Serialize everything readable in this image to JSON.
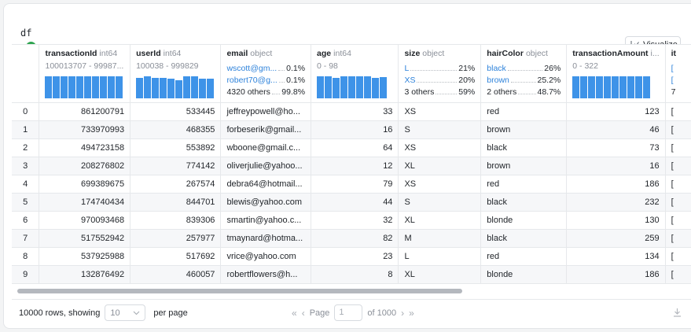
{
  "cell": {
    "code": "df",
    "visualize_label": "Visualize"
  },
  "columns": [
    {
      "name": "transactionId",
      "type": "int64",
      "kind": "numeric",
      "range": "100013707 - 99987...",
      "hist": [
        0.86,
        0.86,
        0.86,
        0.86,
        0.86,
        0.86,
        0.86,
        0.86,
        0.86,
        0.86
      ]
    },
    {
      "name": "userId",
      "type": "int64",
      "kind": "numeric",
      "range": "100038 - 999829",
      "hist": [
        0.8,
        0.86,
        0.8,
        0.8,
        0.77,
        0.72,
        0.86,
        0.86,
        0.79,
        0.79
      ]
    },
    {
      "name": "email",
      "type": "object",
      "kind": "categorical",
      "cats": [
        {
          "label": "wscott@gm...",
          "pct": "0.1%"
        },
        {
          "label": "robert70@g...",
          "pct": "0.1%"
        },
        {
          "label": "4320 others",
          "pct": "99.8%",
          "other": true
        }
      ]
    },
    {
      "name": "age",
      "type": "int64",
      "kind": "numeric",
      "range": "0 - 98",
      "hist": [
        0.86,
        0.86,
        0.8,
        0.86,
        0.86,
        0.86,
        0.86,
        0.8,
        0.83
      ]
    },
    {
      "name": "size",
      "type": "object",
      "kind": "categorical",
      "cats": [
        {
          "label": "L",
          "pct": "21%"
        },
        {
          "label": "XS",
          "pct": "20%"
        },
        {
          "label": "3 others",
          "pct": "59%",
          "other": true
        }
      ]
    },
    {
      "name": "hairColor",
      "type": "object",
      "kind": "categorical",
      "cats": [
        {
          "label": "black",
          "pct": "26%"
        },
        {
          "label": "brown",
          "pct": "25.2%"
        },
        {
          "label": "2 others",
          "pct": "48.7%",
          "other": true
        }
      ]
    },
    {
      "name": "transactionAmount",
      "type": "i...",
      "kind": "numeric",
      "range": "0 - 322",
      "hist": [
        0.86,
        0.86,
        0.86,
        0.86,
        0.86,
        0.86,
        0.86,
        0.86,
        0.86,
        0.86
      ]
    },
    {
      "name": "it",
      "type": "",
      "kind": "partial",
      "cats": [
        {
          "label": "[",
          "pct": ""
        },
        {
          "label": "[",
          "pct": ""
        },
        {
          "label": "7",
          "pct": "",
          "other": true
        }
      ]
    }
  ],
  "rows": [
    [
      "0",
      "861200791",
      "533445",
      "jeffreypowell@ho...",
      "33",
      "XS",
      "red",
      "123",
      "["
    ],
    [
      "1",
      "733970993",
      "468355",
      "forbeserik@gmail...",
      "16",
      "S",
      "brown",
      "46",
      "["
    ],
    [
      "2",
      "494723158",
      "553892",
      "wboone@gmail.c...",
      "64",
      "XS",
      "black",
      "73",
      "["
    ],
    [
      "3",
      "208276802",
      "774142",
      "oliverjulie@yahoo...",
      "12",
      "XL",
      "brown",
      "16",
      "["
    ],
    [
      "4",
      "699389675",
      "267574",
      "debra64@hotmail...",
      "79",
      "XS",
      "red",
      "186",
      "["
    ],
    [
      "5",
      "174740434",
      "844701",
      "blewis@yahoo.com",
      "44",
      "S",
      "black",
      "232",
      "["
    ],
    [
      "6",
      "970093468",
      "839306",
      "smartin@yahoo.c...",
      "32",
      "XL",
      "blonde",
      "130",
      "["
    ],
    [
      "7",
      "517552942",
      "257977",
      "tmaynard@hotma...",
      "82",
      "M",
      "black",
      "259",
      "["
    ],
    [
      "8",
      "537925988",
      "517692",
      "vrice@yahoo.com",
      "23",
      "L",
      "red",
      "134",
      "["
    ],
    [
      "9",
      "132876492",
      "460057",
      "robertflowers@h...",
      "8",
      "XL",
      "blonde",
      "186",
      "["
    ]
  ],
  "footer": {
    "rows_text": "10000 rows, showing",
    "page_size": "10",
    "per_page": "per page",
    "page_label": "Page",
    "page_input": "1",
    "page_total": "of 1000"
  },
  "colors": {
    "accent": "#3e93e8",
    "success": "#2ea44f"
  }
}
